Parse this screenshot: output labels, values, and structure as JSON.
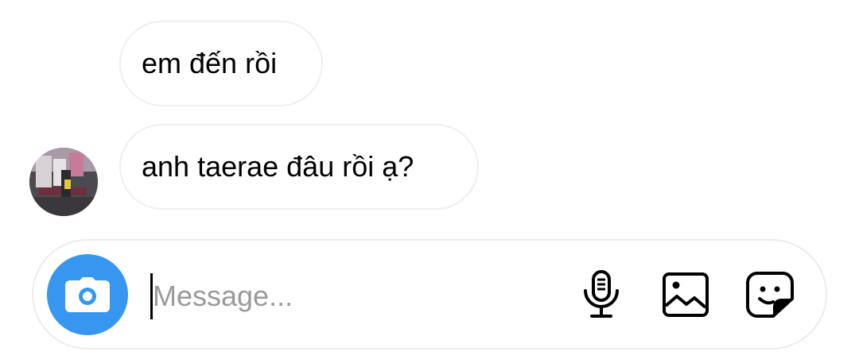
{
  "thread": {
    "messages": [
      {
        "text": "em đến rồi"
      },
      {
        "text": "anh taerae đâu rồi ạ?"
      }
    ],
    "sender_avatar_icon": "avatar-photo"
  },
  "composer": {
    "placeholder": "Message...",
    "value": "",
    "camera_icon": "camera-icon",
    "mic_icon": "microphone-icon",
    "gallery_icon": "image-icon",
    "sticker_icon": "sticker-icon",
    "accent_color": "#3797f0"
  }
}
